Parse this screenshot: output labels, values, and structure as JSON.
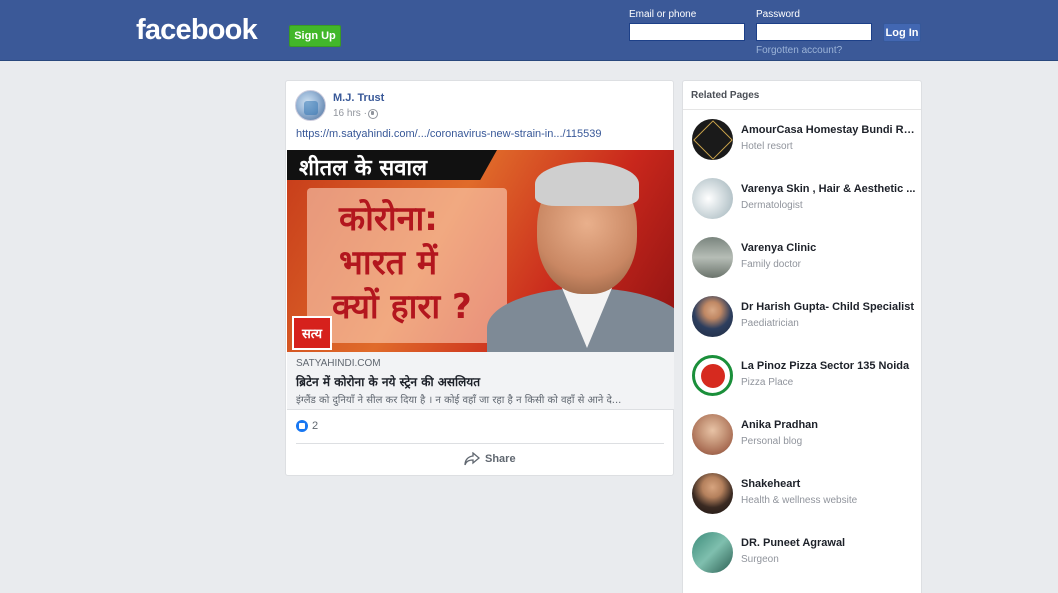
{
  "header": {
    "logo": "facebook",
    "signup_label": "Sign Up",
    "email_label": "Email or phone",
    "password_label": "Password",
    "login_label": "Log In",
    "forgot_label": "Forgotten account?",
    "email_value": "",
    "password_value": ""
  },
  "post": {
    "author": "M.J. Trust",
    "time": "16 hrs · ",
    "link": "https://m.satyahindi.com/.../coronavirus-new-strain-in.../115539",
    "image": {
      "banner": "शीतल के सवाल",
      "line1": "कोरोना:",
      "line2": "भारत में",
      "line3": "क्यों हारा ?",
      "logo": "सत्य"
    },
    "link_domain": "SATYAHINDI.COM",
    "link_title": "ब्रिटेन में कोरोना के नये स्ट्रेन की असलियत",
    "link_desc": "इंग्लैंड को दुनियाँ ने सील कर दिया है । न कोई वहाँ जा रहा है न किसी को वहाँ से आने दे...",
    "reaction_count": "2",
    "share_label": "Share"
  },
  "related": {
    "title": "Related Pages",
    "items": [
      {
        "name": "AmourCasa Homestay Bundi Raj...",
        "category": "Hotel resort",
        "color": "#1a1a1a"
      },
      {
        "name": "Varenya Skin , Hair & Aesthetic ...",
        "category": "Dermatologist",
        "color": "#c9d4d6"
      },
      {
        "name": "Varenya Clinic",
        "category": "Family doctor",
        "color": "#9aa3a0"
      },
      {
        "name": "Dr Harish Gupta- Child Specialist",
        "category": "Paediatrician",
        "color": "#2d3e5e"
      },
      {
        "name": "La Pinoz Pizza Sector 135 Noida",
        "category": "Pizza Place",
        "color": "#1a8f3a"
      },
      {
        "name": "Anika Pradhan",
        "category": "Personal blog",
        "color": "#c7a08a"
      },
      {
        "name": "Shakeheart",
        "category": "Health & wellness website",
        "color": "#6b3b2a"
      },
      {
        "name": "DR. Puneet Agrawal",
        "category": "Surgeon",
        "color": "#2e7a6a"
      }
    ]
  }
}
